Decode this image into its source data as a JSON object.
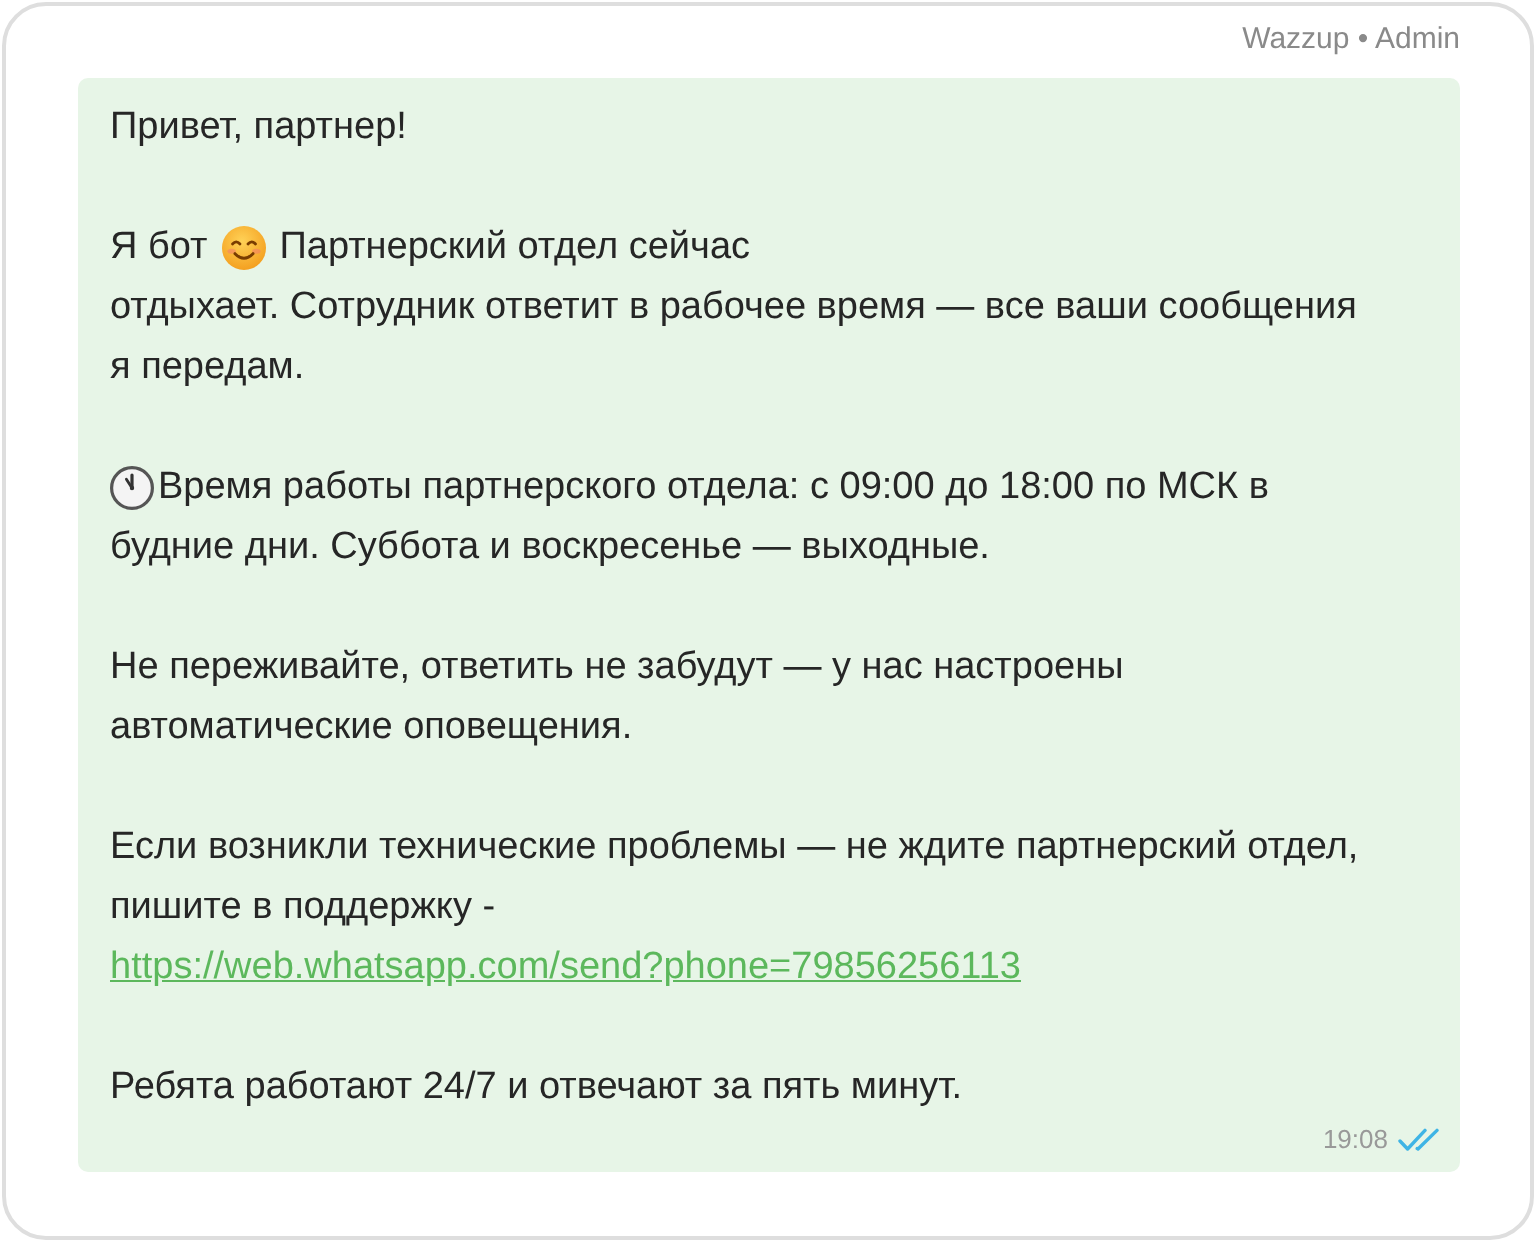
{
  "sender": "Wazzup • Admin",
  "message": {
    "paragraphs": [
      {
        "kind": "plain",
        "text": "Привет, партнер!"
      },
      {
        "kind": "intro",
        "before": "Я бот",
        "after": "Партнерский отдел сейчас",
        "continued": "отдыхает. Сотрудник ответит в рабочее время — все ваши сообщения я передам."
      },
      {
        "kind": "hours",
        "after": "Время работы партнерского отдела: с 09:00 до 18:00 по МСК в",
        "continued": "будние дни. Суббота и воскресенье — выходные."
      },
      {
        "kind": "plain",
        "text": "Не переживайте, ответить не забудут — у нас настроены автоматические оповещения."
      },
      {
        "kind": "support",
        "text": "Если возникли технические проблемы — не ждите партнерский отдел, пишите в поддержку -",
        "link": "https://web.whatsapp.com/send?phone=79856256113"
      },
      {
        "kind": "plain",
        "text": "Ребята работают 24/7 и отвечают за пять минут."
      }
    ],
    "time": "19:08",
    "read": true
  }
}
